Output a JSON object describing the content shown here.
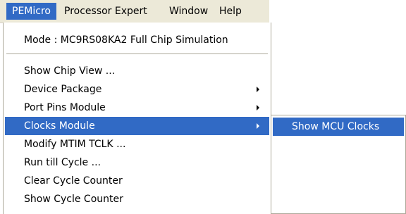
{
  "menubar": {
    "items": [
      {
        "label": "PEMicro",
        "active": true
      },
      {
        "label": "Processor Expert",
        "active": false
      },
      {
        "label": "Window",
        "active": false
      },
      {
        "label": "Help",
        "active": false
      }
    ]
  },
  "menu": {
    "mode_item": "Mode : MC9RS08KA2 Full Chip Simulation",
    "items": [
      {
        "label": "Show Chip View ...",
        "has_submenu": false,
        "highlighted": false
      },
      {
        "label": "Device Package",
        "has_submenu": true,
        "highlighted": false
      },
      {
        "label": "Port Pins Module",
        "has_submenu": true,
        "highlighted": false
      },
      {
        "label": "Clocks Module",
        "has_submenu": true,
        "highlighted": true
      },
      {
        "label": "Modify MTIM TCLK ...",
        "has_submenu": false,
        "highlighted": false
      },
      {
        "label": "Run till Cycle ...",
        "has_submenu": false,
        "highlighted": false
      },
      {
        "label": "Clear Cycle Counter",
        "has_submenu": false,
        "highlighted": false
      },
      {
        "label": "Show Cycle Counter",
        "has_submenu": false,
        "highlighted": false
      }
    ]
  },
  "submenu": {
    "items": [
      {
        "label": "Show MCU Clocks",
        "highlighted": true
      }
    ]
  },
  "colors": {
    "highlight": "#316ac5",
    "menubar_background": "#ece9d8",
    "menu_border": "#aca899"
  },
  "icons": {
    "submenu_arrow": "submenu-arrow-icon"
  }
}
